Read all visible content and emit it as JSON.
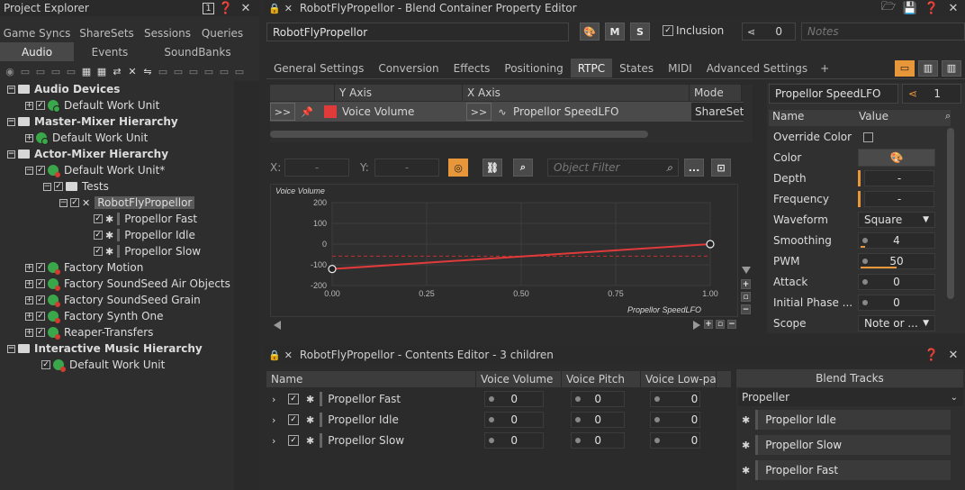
{
  "project_explorer": {
    "title": "Project Explorer",
    "tabs_row1": [
      "Game Syncs",
      "ShareSets",
      "Sessions",
      "Queries"
    ],
    "tabs_row2": [
      "Audio",
      "Events",
      "SoundBanks"
    ],
    "active_tab": "Audio",
    "tree": [
      {
        "label": "Audio Devices",
        "bold": true
      },
      {
        "label": "Default Work Unit"
      },
      {
        "label": "Master-Mixer Hierarchy",
        "bold": true
      },
      {
        "label": "Default Work Unit"
      },
      {
        "label": "Actor-Mixer Hierarchy",
        "bold": true
      },
      {
        "label": "Default Work Unit*"
      },
      {
        "label": "Tests"
      },
      {
        "label": "RobotFlyPropellor",
        "selected": true
      },
      {
        "label": "Propellor Fast"
      },
      {
        "label": "Propellor Idle"
      },
      {
        "label": "Propellor Slow"
      },
      {
        "label": "Factory Motion"
      },
      {
        "label": "Factory SoundSeed Air Objects"
      },
      {
        "label": "Factory SoundSeed Grain"
      },
      {
        "label": "Factory Synth One"
      },
      {
        "label": "Reaper-Transfers"
      },
      {
        "label": "Interactive Music Hierarchy",
        "bold": true
      },
      {
        "label": "Default Work Unit"
      }
    ]
  },
  "property_editor": {
    "title": "RobotFlyPropellor - Blend Container Property Editor",
    "name_value": "RobotFlyPropellor",
    "m_label": "M",
    "s_label": "S",
    "inclusion_label": "Inclusion",
    "link_count": "0",
    "notes_placeholder": "Notes",
    "tabs": [
      "General Settings",
      "Conversion",
      "Effects",
      "Positioning",
      "RTPC",
      "States",
      "MIDI",
      "Advanced Settings",
      "+"
    ],
    "active_tab": "RTPC",
    "rtpc_grid": {
      "headers": [
        "Y Axis",
        "X Axis",
        "Mode"
      ],
      "row": {
        "expand": ">>",
        "y_axis": "Voice Volume",
        "expand2": ">>",
        "x_axis": "Propellor SpeedLFO",
        "mode": "ShareSet"
      }
    },
    "x_label": "X:",
    "x_value": "-",
    "y_label": "Y:",
    "y_value": "-",
    "object_filter_placeholder": "Object Filter",
    "ellipsis": "...",
    "lfo_name": "Propellor SpeedLFO",
    "lfo_count": "1",
    "props_headers": [
      "Name",
      "Value"
    ],
    "props": [
      {
        "name": "Override Color",
        "value": ""
      },
      {
        "name": "Color",
        "value": ""
      },
      {
        "name": "Depth",
        "value": "-"
      },
      {
        "name": "Frequency",
        "value": "-"
      },
      {
        "name": "Waveform",
        "value": "Square"
      },
      {
        "name": "Smoothing",
        "value": "4"
      },
      {
        "name": "PWM",
        "value": "50"
      },
      {
        "name": "Attack",
        "value": "0"
      },
      {
        "name": "Initial Phase ...",
        "value": "0"
      },
      {
        "name": "Scope",
        "value": "Note or ..."
      }
    ]
  },
  "chart_data": {
    "type": "line",
    "ylabel": "Voice Volume",
    "xlabel": "Propellor SpeedLFO",
    "y_ticks": [
      "200",
      "100",
      "0",
      "-100",
      "-200"
    ],
    "x_ticks": [
      "0.00",
      "0.25",
      "0.50",
      "0.75",
      "1.00"
    ],
    "xlim": [
      0,
      1
    ],
    "ylim": [
      -200,
      200
    ],
    "series": [
      {
        "x": [
          0,
          1
        ],
        "y": [
          -120,
          0
        ]
      }
    ],
    "reference_y": -58
  },
  "contents_editor": {
    "title": "RobotFlyPropellor - Contents Editor - 3 children",
    "headers": [
      "Name",
      "Voice Volume",
      "Voice Pitch",
      "Voice Low-pass"
    ],
    "rows": [
      {
        "name": "Propellor Fast",
        "volume": "0",
        "pitch": "0",
        "lowpass": "0"
      },
      {
        "name": "Propellor Idle",
        "volume": "0",
        "pitch": "0",
        "lowpass": "0"
      },
      {
        "name": "Propellor Slow",
        "volume": "0",
        "pitch": "0",
        "lowpass": "0"
      }
    ],
    "blend_tracks_title": "Blend Tracks",
    "blend_track_name": "Propeller",
    "blend_items": [
      "Propellor Idle",
      "Propellor Slow",
      "Propellor Fast"
    ]
  },
  "colors": {
    "accent_orange": "#e8963a",
    "curve_red": "#e03a3a",
    "selected_bg": "#5a5a5a"
  }
}
